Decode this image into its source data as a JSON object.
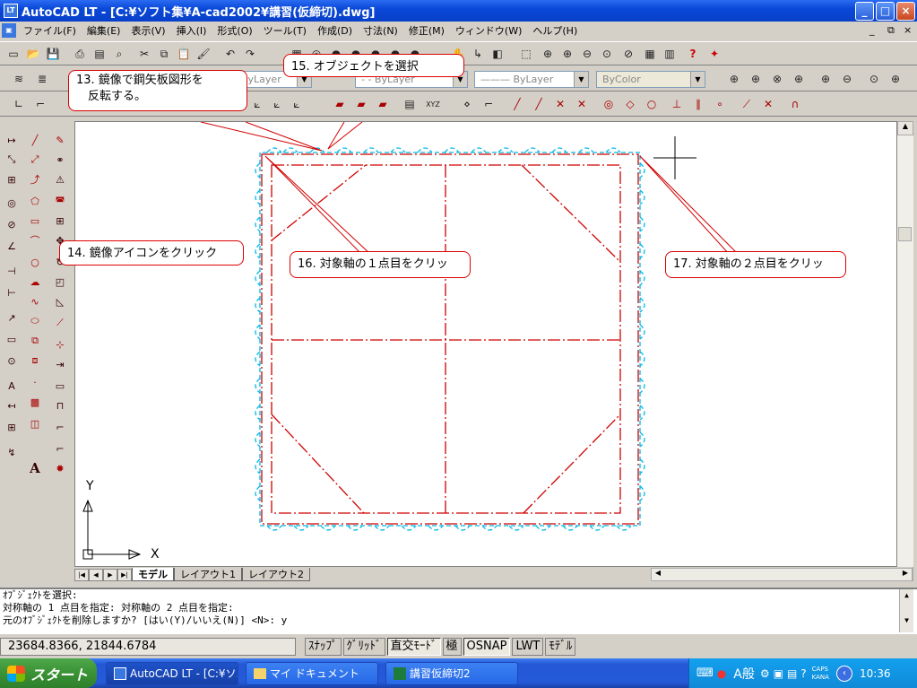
{
  "window": {
    "title": "AutoCAD LT - [C:¥ソフト集¥A-cad2002¥講習(仮締切).dwg]",
    "app_icon": "LT"
  },
  "menu": [
    "ファイル(F)",
    "編集(E)",
    "表示(V)",
    "挿入(I)",
    "形式(O)",
    "ツール(T)",
    "作成(D)",
    "寸法(N)",
    "修正(M)",
    "ウィンドウ(W)",
    "ヘルプ(H)"
  ],
  "properties": {
    "layer_combo": "ByLayer",
    "linetype_combo": "- - ByLayer",
    "lineweight_combo": "——— ByLayer",
    "color_combo": "ByColor"
  },
  "callouts": {
    "c13": "13. 鏡像で鋼矢板図形を\n　反転する。",
    "c14": "14. 鏡像アイコンをクリック",
    "c15": "15. オブジェクトを選択",
    "c16": "16. 対象軸の１点目をクリッ",
    "c17": "17. 対象軸の２点目をクリッ"
  },
  "ucs": {
    "x": "X",
    "y": "Y"
  },
  "layout_tabs": [
    "モデル",
    "レイアウト1",
    "レイアウト2"
  ],
  "command_lines": [
    "ｵﾌﾞｼﾞｪｸﾄを選択:",
    "対称軸の 1 点目を指定: 対称軸の 2 点目を指定:",
    "元のｵﾌﾞｼﾞｪｸﾄを削除しますか? [はい(Y)/いいえ(N)] <N>: y"
  ],
  "status": {
    "coords": "23684.8366, 21844.6784",
    "buttons": [
      "ｽﾅｯﾌﾟ",
      "ｸﾞﾘｯﾄﾞ",
      "直交ﾓｰﾄﾞ",
      "極",
      "OSNAP",
      "LWT",
      "ﾓﾃﾞﾙ"
    ]
  },
  "taskbar": {
    "start": "スタート",
    "tasks": [
      "AutoCAD LT - [C:¥ソ...",
      "マイ ドキュメント",
      "講習仮締切2"
    ],
    "tray_ime": "A般",
    "caps": "CAPS",
    "kana": "KANA",
    "clock": "10:36"
  },
  "colors": {
    "drawing_red": "#d00000",
    "sheetpile_cyan": "#00b8e8",
    "callout_border": "#dd0000"
  }
}
